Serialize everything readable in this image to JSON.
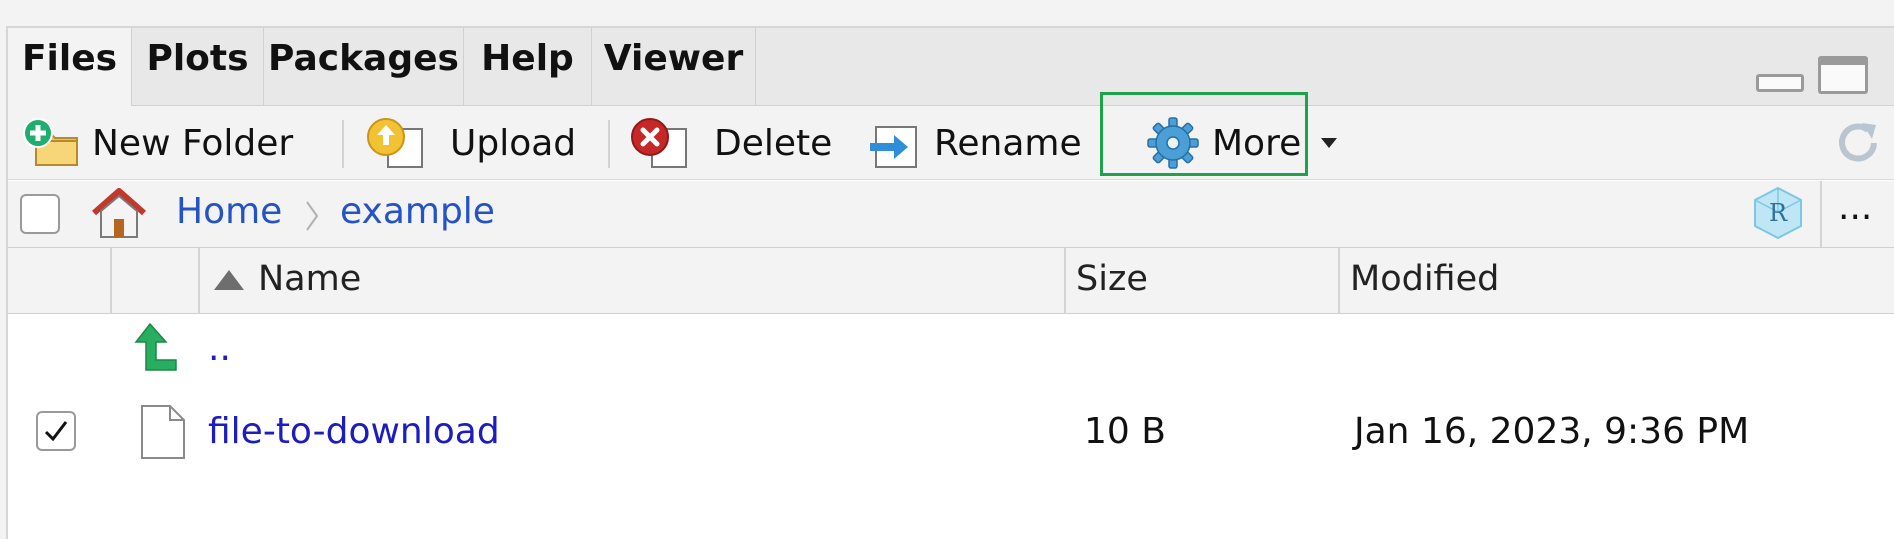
{
  "tabs": [
    {
      "label": "Files",
      "active": true
    },
    {
      "label": "Plots",
      "active": false
    },
    {
      "label": "Packages",
      "active": false
    },
    {
      "label": "Help",
      "active": false
    },
    {
      "label": "Viewer",
      "active": false
    }
  ],
  "toolbar": {
    "new_folder": "New Folder",
    "upload": "Upload",
    "delete": "Delete",
    "rename": "Rename",
    "more": "More",
    "highlight_color": "#1fa34a"
  },
  "path": {
    "home": "Home",
    "folder": "example",
    "overflow": "..."
  },
  "columns": {
    "name": "Name",
    "size": "Size",
    "modified": "Modified"
  },
  "files": [
    {
      "name": "..",
      "size": "",
      "modified": "",
      "checked": false,
      "kind": "parent"
    },
    {
      "name": "file-to-download",
      "size": "10 B",
      "modified": "Jan 16, 2023, 9:36 PM",
      "checked": true,
      "kind": "file"
    }
  ],
  "colors": {
    "link": "#1c1cc0",
    "breadcrumb": "#2453c5",
    "up_arrow": "#27ae60"
  }
}
